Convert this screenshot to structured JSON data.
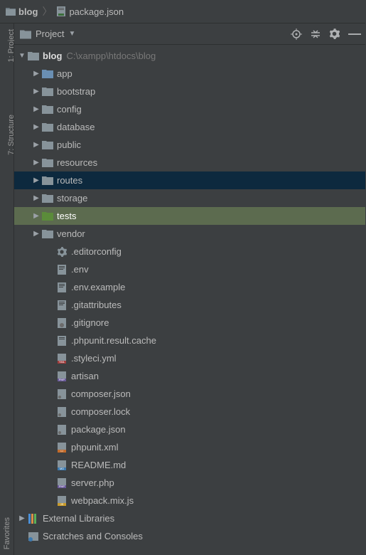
{
  "breadcrumb": {
    "root": "blog",
    "file": "package.json"
  },
  "vtabs": {
    "project": "1: Project",
    "structure": "7: Structure",
    "favorites": "Favorites"
  },
  "panel": {
    "title": "Project"
  },
  "tree": {
    "root": {
      "name": "blog",
      "path": "C:\\xampp\\htdocs\\blog"
    },
    "folders": [
      "app",
      "bootstrap",
      "config",
      "database",
      "public",
      "resources",
      "routes",
      "storage",
      "tests",
      "vendor"
    ],
    "files": {
      "editorconfig": ".editorconfig",
      "env": ".env",
      "envexample": ".env.example",
      "gitattributes": ".gitattributes",
      "gitignore": ".gitignore",
      "phpunitcache": ".phpunit.result.cache",
      "styleci": ".styleci.yml",
      "artisan": "artisan",
      "composerjson": "composer.json",
      "composerlock": "composer.lock",
      "packagejson": "package.json",
      "phpunitxml": "phpunit.xml",
      "readme": "README.md",
      "serverphp": "server.php",
      "webpack": "webpack.mix.js"
    },
    "external": "External Libraries",
    "scratches": "Scratches and Consoles"
  }
}
